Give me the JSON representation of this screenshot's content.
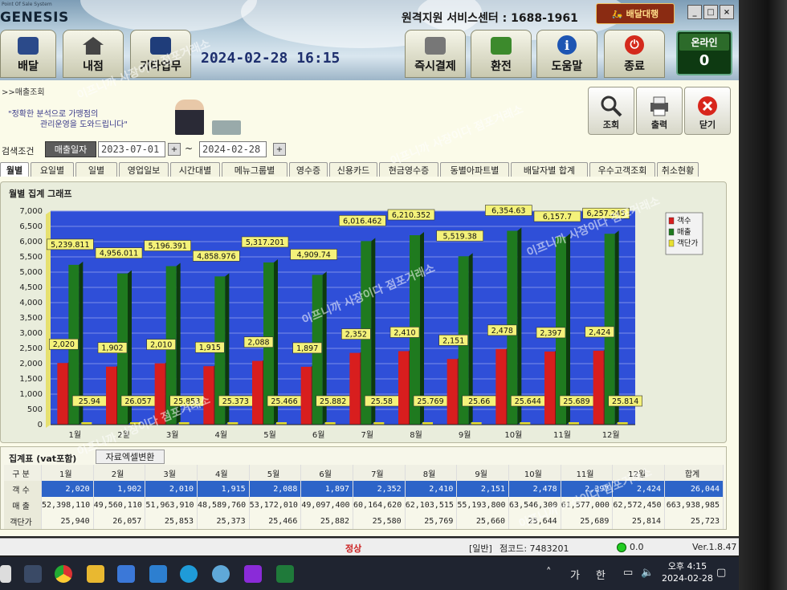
{
  "app": {
    "logo": "GENESIS",
    "logo_tag": "Point Of Sale System",
    "datetime": "2024-02-28 16:15",
    "service_center": "원격지원 서비스센터 : 1688-1961",
    "delivery_label": "배달대행",
    "nav": [
      {
        "label": "배달",
        "icon": "delivery-icon"
      },
      {
        "label": "내점",
        "icon": "house-icon"
      },
      {
        "label": "기타업무",
        "icon": "book-icon"
      },
      {
        "label": "즉시결제",
        "icon": "card-terminal-icon"
      },
      {
        "label": "환전",
        "icon": "money-icon"
      },
      {
        "label": "도움말",
        "icon": "info-icon"
      },
      {
        "label": "종료",
        "icon": "power-icon"
      }
    ],
    "online": {
      "label": "온라인",
      "count": "0"
    },
    "window_buttons": [
      "_",
      "□",
      "×"
    ]
  },
  "page": {
    "breadcrumb": ">>매출조회",
    "banner_line1": "\"정확한 분석으로 가맹점의",
    "banner_line2": "관리운영을 도와드립니다\"",
    "tools": [
      {
        "label": "조회",
        "icon": "magnifier-icon"
      },
      {
        "label": "출력",
        "icon": "printer-icon"
      },
      {
        "label": "닫기",
        "icon": "close-icon"
      }
    ]
  },
  "search": {
    "label": "검색조건",
    "type": "매출일자",
    "from": "2023-07-01",
    "to": "2024-02-28",
    "plus": "+",
    "tilde": "~"
  },
  "tabs": [
    "월별",
    "요일별",
    "일별",
    "영업일보",
    "시간대별",
    "메뉴그룹별",
    "영수증",
    "신용카드",
    "현금영수증",
    "동별아파트별",
    "배달자별 합계",
    "우수고객조회",
    "취소현황"
  ],
  "graph": {
    "title": "월별 집계 그래프"
  },
  "chart_data": {
    "type": "bar",
    "title": "",
    "categories": [
      "1월",
      "2월",
      "3월",
      "4월",
      "5월",
      "6월",
      "7월",
      "8월",
      "9월",
      "10월",
      "11월",
      "12월"
    ],
    "ylim": [
      0,
      7000
    ],
    "yticks": [
      "0",
      "500",
      "1,000",
      "1,500",
      "2,000",
      "2,500",
      "3,000",
      "3,500",
      "4,000",
      "4,500",
      "5,000",
      "5,500",
      "6,000",
      "6,500",
      "7,000"
    ],
    "series": [
      {
        "name": "객수",
        "color": "#d81e1e",
        "values": [
          2020,
          1902,
          2010,
          1915,
          2088,
          1897,
          2352,
          2410,
          2151,
          2478,
          2397,
          2424
        ],
        "labels": [
          "2,020",
          "1,902",
          "2,010",
          "1,915",
          "2,088",
          "1,897",
          "2,352",
          "2,410",
          "2,151",
          "2,478",
          "2,397",
          "2,424"
        ]
      },
      {
        "name": "매출",
        "color": "#1f7a1f",
        "values": [
          5239.811,
          4956.011,
          5196.391,
          4858.976,
          5317.201,
          4909.74,
          6016.462,
          6210.352,
          5519.38,
          6354.63,
          6157.7,
          6257.245
        ],
        "labels": [
          "5,239.811",
          "4,956.011",
          "5,196.391",
          "4,858.976",
          "5,317.201",
          "4,909.74",
          "6,016.462",
          "6,210.352",
          "5,519.38",
          "6,354.63",
          "6,157.7",
          "6,257.245"
        ]
      },
      {
        "name": "객단가",
        "color": "#e8e030",
        "values": [
          25.94,
          26.057,
          25.853,
          25.373,
          25.466,
          25.882,
          25.58,
          25.769,
          25.66,
          25.644,
          25.689,
          25.814
        ],
        "labels": [
          "25.94",
          "26.057",
          "25.853",
          "25.373",
          "25.466",
          "25.882",
          "25.58",
          "25.769",
          "25.66",
          "25.644",
          "25.689",
          "25.814"
        ]
      }
    ],
    "legend_position": "right",
    "grid": true
  },
  "summary": {
    "title": "집계표 (vat포함)",
    "excel_button": "자료엑셀변환",
    "header": [
      "구 분",
      "1월",
      "2월",
      "3월",
      "4월",
      "5월",
      "6월",
      "7월",
      "8월",
      "9월",
      "10월",
      "11월",
      "12월",
      "합계"
    ],
    "rows": [
      {
        "label": "객 수",
        "cells": [
          "2,020",
          "1,902",
          "2,010",
          "1,915",
          "2,088",
          "1,897",
          "2,352",
          "2,410",
          "2,151",
          "2,478",
          "2,397",
          "2,424",
          "26,044"
        ]
      },
      {
        "label": "매 출",
        "cells": [
          "52,398,110",
          "49,560,110",
          "51,963,910",
          "48,589,760",
          "53,172,010",
          "49,097,400",
          "60,164,620",
          "62,103,515",
          "55,193,800",
          "63,546,300",
          "61,577,000",
          "62,572,450",
          "663,938,985"
        ]
      },
      {
        "label": "객단가",
        "cells": [
          "25,940",
          "26,057",
          "25,853",
          "25,373",
          "25,466",
          "25,882",
          "25,580",
          "25,769",
          "25,660",
          "25,644",
          "25,689",
          "25,814",
          "25,723"
        ]
      }
    ]
  },
  "status": {
    "state": "정상",
    "mode": "[일반]",
    "store": "점코드: 7483201",
    "value": "0.0",
    "version": "Ver.1.8.47"
  },
  "taskbar": {
    "tray_ime": "가",
    "tray_lang": "한",
    "time": "오후 4:15",
    "date": "2024-02-28"
  },
  "watermark": "이프니까 사장이다 점포거래소"
}
